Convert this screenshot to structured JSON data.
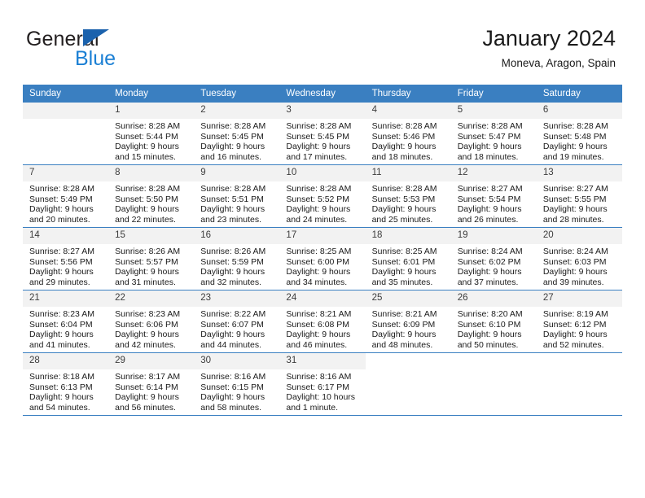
{
  "brand": {
    "name_part1": "General",
    "name_part2": "Blue",
    "triangle_color": "#1b62ad",
    "blue_color": "#1a7fd4"
  },
  "header": {
    "title": "January 2024",
    "subtitle": "Moneva, Aragon, Spain"
  },
  "theme": {
    "header_bg": "#3a7fc1",
    "daynum_bg": "#f2f2f2",
    "grid_line": "#3a7fc1",
    "text": "#1a1a1a"
  },
  "weekdays": [
    "Sunday",
    "Monday",
    "Tuesday",
    "Wednesday",
    "Thursday",
    "Friday",
    "Saturday"
  ],
  "weeks": [
    [
      {
        "day": "",
        "lines": []
      },
      {
        "day": "1",
        "lines": [
          "Sunrise: 8:28 AM",
          "Sunset: 5:44 PM",
          "Daylight: 9 hours",
          "and 15 minutes."
        ]
      },
      {
        "day": "2",
        "lines": [
          "Sunrise: 8:28 AM",
          "Sunset: 5:45 PM",
          "Daylight: 9 hours",
          "and 16 minutes."
        ]
      },
      {
        "day": "3",
        "lines": [
          "Sunrise: 8:28 AM",
          "Sunset: 5:45 PM",
          "Daylight: 9 hours",
          "and 17 minutes."
        ]
      },
      {
        "day": "4",
        "lines": [
          "Sunrise: 8:28 AM",
          "Sunset: 5:46 PM",
          "Daylight: 9 hours",
          "and 18 minutes."
        ]
      },
      {
        "day": "5",
        "lines": [
          "Sunrise: 8:28 AM",
          "Sunset: 5:47 PM",
          "Daylight: 9 hours",
          "and 18 minutes."
        ]
      },
      {
        "day": "6",
        "lines": [
          "Sunrise: 8:28 AM",
          "Sunset: 5:48 PM",
          "Daylight: 9 hours",
          "and 19 minutes."
        ]
      }
    ],
    [
      {
        "day": "7",
        "lines": [
          "Sunrise: 8:28 AM",
          "Sunset: 5:49 PM",
          "Daylight: 9 hours",
          "and 20 minutes."
        ]
      },
      {
        "day": "8",
        "lines": [
          "Sunrise: 8:28 AM",
          "Sunset: 5:50 PM",
          "Daylight: 9 hours",
          "and 22 minutes."
        ]
      },
      {
        "day": "9",
        "lines": [
          "Sunrise: 8:28 AM",
          "Sunset: 5:51 PM",
          "Daylight: 9 hours",
          "and 23 minutes."
        ]
      },
      {
        "day": "10",
        "lines": [
          "Sunrise: 8:28 AM",
          "Sunset: 5:52 PM",
          "Daylight: 9 hours",
          "and 24 minutes."
        ]
      },
      {
        "day": "11",
        "lines": [
          "Sunrise: 8:28 AM",
          "Sunset: 5:53 PM",
          "Daylight: 9 hours",
          "and 25 minutes."
        ]
      },
      {
        "day": "12",
        "lines": [
          "Sunrise: 8:27 AM",
          "Sunset: 5:54 PM",
          "Daylight: 9 hours",
          "and 26 minutes."
        ]
      },
      {
        "day": "13",
        "lines": [
          "Sunrise: 8:27 AM",
          "Sunset: 5:55 PM",
          "Daylight: 9 hours",
          "and 28 minutes."
        ]
      }
    ],
    [
      {
        "day": "14",
        "lines": [
          "Sunrise: 8:27 AM",
          "Sunset: 5:56 PM",
          "Daylight: 9 hours",
          "and 29 minutes."
        ]
      },
      {
        "day": "15",
        "lines": [
          "Sunrise: 8:26 AM",
          "Sunset: 5:57 PM",
          "Daylight: 9 hours",
          "and 31 minutes."
        ]
      },
      {
        "day": "16",
        "lines": [
          "Sunrise: 8:26 AM",
          "Sunset: 5:59 PM",
          "Daylight: 9 hours",
          "and 32 minutes."
        ]
      },
      {
        "day": "17",
        "lines": [
          "Sunrise: 8:25 AM",
          "Sunset: 6:00 PM",
          "Daylight: 9 hours",
          "and 34 minutes."
        ]
      },
      {
        "day": "18",
        "lines": [
          "Sunrise: 8:25 AM",
          "Sunset: 6:01 PM",
          "Daylight: 9 hours",
          "and 35 minutes."
        ]
      },
      {
        "day": "19",
        "lines": [
          "Sunrise: 8:24 AM",
          "Sunset: 6:02 PM",
          "Daylight: 9 hours",
          "and 37 minutes."
        ]
      },
      {
        "day": "20",
        "lines": [
          "Sunrise: 8:24 AM",
          "Sunset: 6:03 PM",
          "Daylight: 9 hours",
          "and 39 minutes."
        ]
      }
    ],
    [
      {
        "day": "21",
        "lines": [
          "Sunrise: 8:23 AM",
          "Sunset: 6:04 PM",
          "Daylight: 9 hours",
          "and 41 minutes."
        ]
      },
      {
        "day": "22",
        "lines": [
          "Sunrise: 8:23 AM",
          "Sunset: 6:06 PM",
          "Daylight: 9 hours",
          "and 42 minutes."
        ]
      },
      {
        "day": "23",
        "lines": [
          "Sunrise: 8:22 AM",
          "Sunset: 6:07 PM",
          "Daylight: 9 hours",
          "and 44 minutes."
        ]
      },
      {
        "day": "24",
        "lines": [
          "Sunrise: 8:21 AM",
          "Sunset: 6:08 PM",
          "Daylight: 9 hours",
          "and 46 minutes."
        ]
      },
      {
        "day": "25",
        "lines": [
          "Sunrise: 8:21 AM",
          "Sunset: 6:09 PM",
          "Daylight: 9 hours",
          "and 48 minutes."
        ]
      },
      {
        "day": "26",
        "lines": [
          "Sunrise: 8:20 AM",
          "Sunset: 6:10 PM",
          "Daylight: 9 hours",
          "and 50 minutes."
        ]
      },
      {
        "day": "27",
        "lines": [
          "Sunrise: 8:19 AM",
          "Sunset: 6:12 PM",
          "Daylight: 9 hours",
          "and 52 minutes."
        ]
      }
    ],
    [
      {
        "day": "28",
        "lines": [
          "Sunrise: 8:18 AM",
          "Sunset: 6:13 PM",
          "Daylight: 9 hours",
          "and 54 minutes."
        ]
      },
      {
        "day": "29",
        "lines": [
          "Sunrise: 8:17 AM",
          "Sunset: 6:14 PM",
          "Daylight: 9 hours",
          "and 56 minutes."
        ]
      },
      {
        "day": "30",
        "lines": [
          "Sunrise: 8:16 AM",
          "Sunset: 6:15 PM",
          "Daylight: 9 hours",
          "and 58 minutes."
        ]
      },
      {
        "day": "31",
        "lines": [
          "Sunrise: 8:16 AM",
          "Sunset: 6:17 PM",
          "Daylight: 10 hours",
          "and 1 minute."
        ]
      },
      {
        "day": "",
        "lines": []
      },
      {
        "day": "",
        "lines": []
      },
      {
        "day": "",
        "lines": []
      }
    ]
  ]
}
